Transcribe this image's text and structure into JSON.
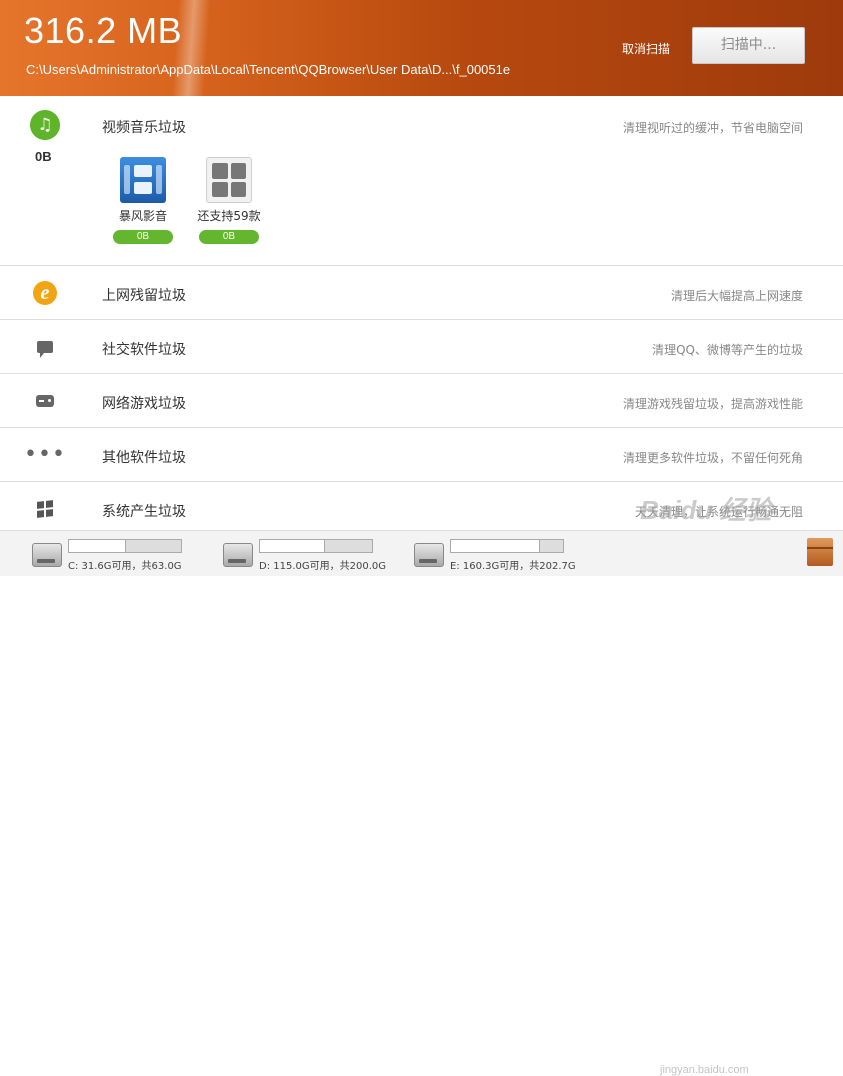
{
  "header": {
    "size": "316.2 MB",
    "path": "C:\\Users\\Administrator\\AppData\\Local\\Tencent\\QQBrowser\\User Data\\D...\\f_00051e",
    "cancel_label": "取消扫描",
    "scan_button_label": "扫描中..."
  },
  "sections": {
    "video": {
      "title": "视频音乐垃圾",
      "desc": "清理视听过的缓冲，节省电脑空间",
      "size": "0B",
      "icon": "music-note-icon",
      "apps": [
        {
          "label": "暴风影音",
          "size": "0B",
          "icon": "baofeng-player-icon"
        },
        {
          "label": "还支持59款",
          "size": "0B",
          "icon": "more-apps-icon"
        }
      ]
    },
    "web": {
      "title": "上网残留垃圾",
      "desc": "清理后大幅提高上网速度",
      "icon": "ie-browser-icon"
    },
    "social": {
      "title": "社交软件垃圾",
      "desc": "清理QQ、微博等产生的垃圾",
      "icon": "chat-bubble-icon"
    },
    "game": {
      "title": "网络游戏垃圾",
      "desc": "清理游戏残留垃圾，提高游戏性能",
      "icon": "gamepad-icon"
    },
    "other": {
      "title": "其他软件垃圾",
      "desc": "清理更多软件垃圾，不留任何死角",
      "icon": "more-dots-icon"
    },
    "system": {
      "title": "系统产生垃圾",
      "desc": "天天清理，让系统运行畅通无阻",
      "icon": "windows-icon"
    }
  },
  "drives": [
    {
      "label": "C: 31.6G可用，共63.0G",
      "free_fraction": 0.5
    },
    {
      "label": "D: 115.0G可用，共200.0G",
      "free_fraction": 0.575
    },
    {
      "label": "E: 160.3G可用，共202.7G",
      "free_fraction": 0.79
    }
  ],
  "watermark": {
    "brand": "Baidu 经验",
    "url": "jingyan.baidu.com"
  },
  "colors": {
    "header_start": "#e6752c",
    "header_end": "#9e3a0c",
    "pill_green": "#63b62e",
    "music_green": "#5fb52a"
  }
}
